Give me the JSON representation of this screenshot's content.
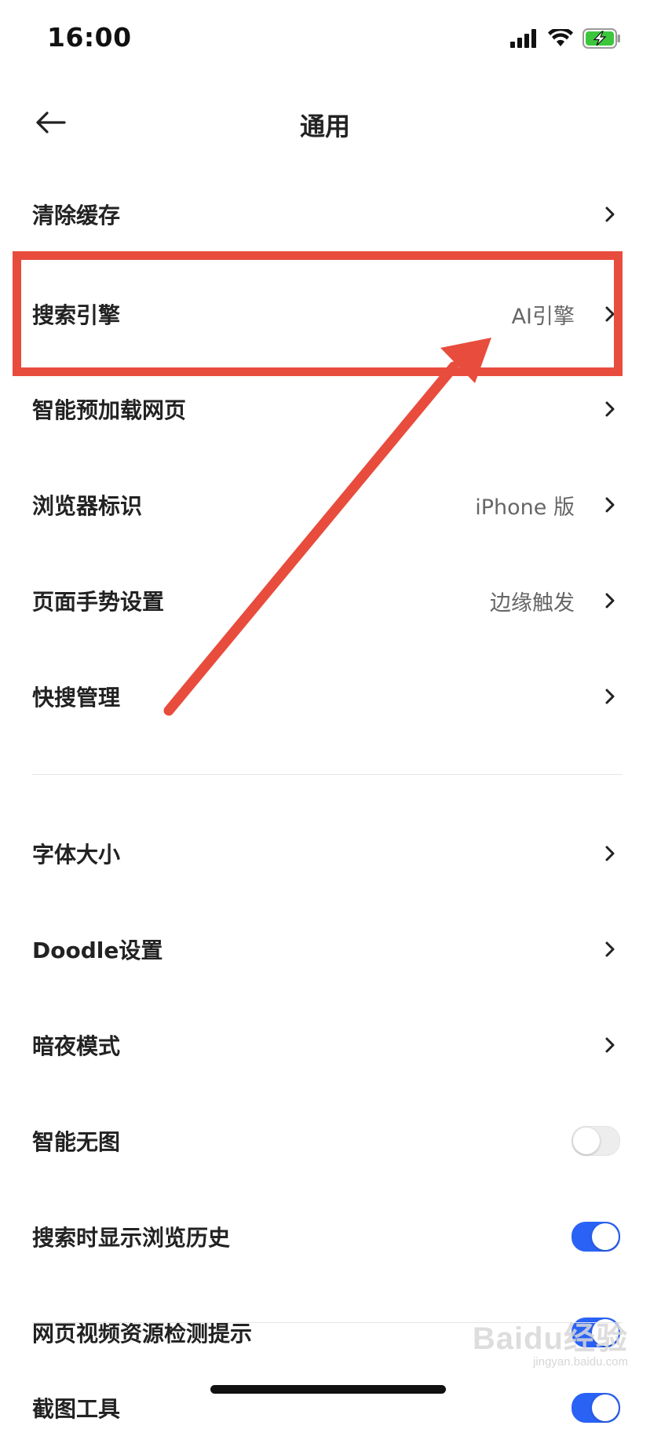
{
  "status_bar": {
    "time": "16:00",
    "icons": [
      "cellular-signal-icon",
      "wifi-icon",
      "battery-charging-icon"
    ]
  },
  "nav": {
    "back_icon": "arrow-left-icon",
    "title": "通用"
  },
  "settings": {
    "group1": [
      {
        "label": "清除缓存",
        "value": ""
      },
      {
        "label": "搜索引擎",
        "value": "AI引擎"
      },
      {
        "label": "智能预加载网页",
        "value": ""
      },
      {
        "label": "浏览器标识",
        "value": "iPhone 版"
      },
      {
        "label": "页面手势设置",
        "value": "边缘触发"
      },
      {
        "label": "快搜管理",
        "value": ""
      }
    ],
    "group2": [
      {
        "label": "字体大小"
      },
      {
        "label": "Doodle设置"
      },
      {
        "label": "暗夜模式"
      }
    ],
    "toggles": [
      {
        "label": "智能无图",
        "on": false
      },
      {
        "label": "搜索时显示浏览历史",
        "on": true
      },
      {
        "label": "网页视频资源检测提示",
        "on": true
      },
      {
        "label": "截图工具",
        "on": true
      }
    ]
  },
  "colors": {
    "accent": "#2a62f5",
    "annotation": "#e84c3d",
    "text": "#222222",
    "secondary_text": "#666666"
  },
  "watermark": {
    "brand": "Baidu经验",
    "site": "jingyan.baidu.com"
  }
}
